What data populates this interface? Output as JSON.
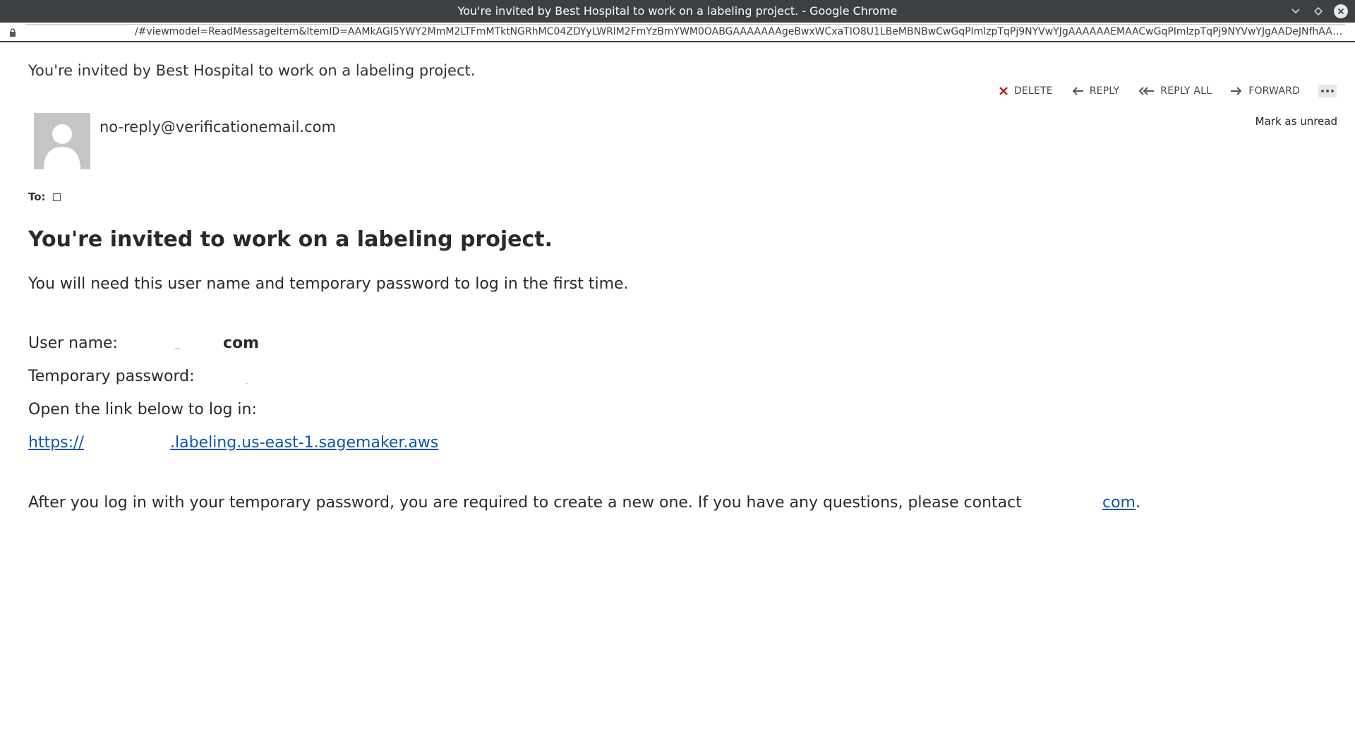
{
  "window": {
    "title": "You're invited by Best Hospital to work on a labeling project. - Google Chrome",
    "url": "/#viewmodel=ReadMessageItem&ItemID=AAMkAGI5YWY2MmM2LTFmMTktNGRhMC04ZDYyLWRlM2FmYzBmYWM0OABGAAAAAAAgeBwxWCxaTIO8U1LBeMBNBwCwGqPImlzpTqPj9NYVwYJgAAAAAAEMAACwGqPImlzpTqPj9NYVwYJgAADeJNfhAAA%3D&wid=39&isp..."
  },
  "message": {
    "subject": "You're invited by Best Hospital to work on a labeling project.",
    "sender": "no-reply@verificationemail.com",
    "to_label": "To:",
    "mark_unread": "Mark as unread",
    "actions": {
      "delete": "DELETE",
      "reply": "REPLY",
      "reply_all": "REPLY ALL",
      "forward": "FORWARD"
    }
  },
  "body": {
    "heading": "You're invited to work on a labeling project.",
    "intro": "You will need this user name and temporary password to log in the first time.",
    "username_label": "User name:",
    "username_value": "com",
    "password_label": "Temporary password:",
    "open_link_text": "Open the link below to log in:",
    "link_prefix": "https://",
    "link_suffix": ".labeling.us-east-1.sagemaker.aws",
    "after_text": "After you log in with your temporary password, you are required to create a new one. If you have any questions, please contact",
    "contact_suffix": "com",
    "contact_period": "."
  },
  "colors": {
    "titlebar": "#3c4043",
    "link": "#0b57a8",
    "delete_icon": "#c0202a"
  },
  "icons": {
    "lock": "lock-icon",
    "delete": "close-x-icon",
    "reply": "arrow-left-icon",
    "reply_all": "double-arrow-left-icon",
    "forward": "arrow-right-icon",
    "more": "ellipsis-icon",
    "avatar": "person-silhouette-icon"
  }
}
